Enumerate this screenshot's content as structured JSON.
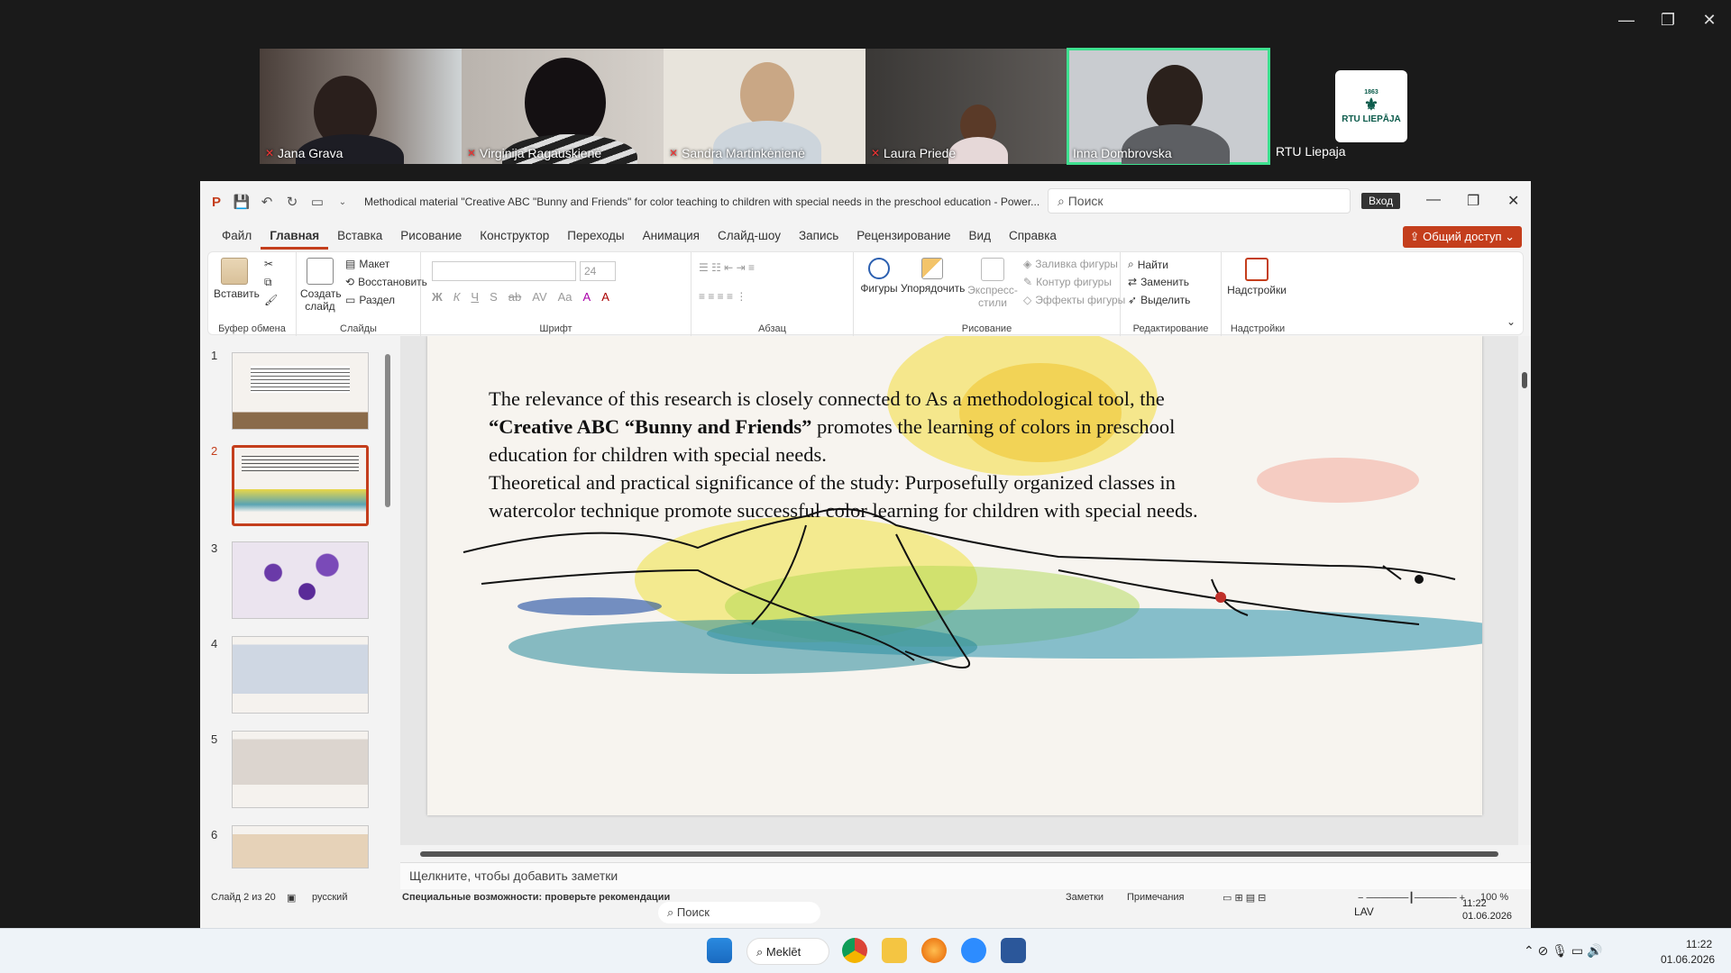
{
  "window_controls": {
    "minimize": "—",
    "restore": "❐",
    "close": "✕"
  },
  "participants": [
    {
      "name": "Jana Grava",
      "muted": true
    },
    {
      "name": "Virginija Ragauskienė",
      "muted": true
    },
    {
      "name": "Sandra Martinkėnienė",
      "muted": true
    },
    {
      "name": "Laura Priede",
      "muted": true
    },
    {
      "name": "Inna Dombrovska",
      "muted": false,
      "active": true
    },
    {
      "name": "RTU Liepaja",
      "muted": false
    }
  ],
  "rtu_logo": {
    "text": "RTU LIEPĀJA",
    "year": "1863"
  },
  "ppt": {
    "title": "Methodical material \"Creative ABC \"Bunny and Friends\" for color teaching to children with special needs in the  preschool education  -  Power...",
    "search_placeholder": "Поиск",
    "signin": "Вход",
    "tabs": [
      "Файл",
      "Главная",
      "Вставка",
      "Рисование",
      "Конструктор",
      "Переходы",
      "Анимация",
      "Слайд-шоу",
      "Запись",
      "Рецензирование",
      "Вид",
      "Справка"
    ],
    "selected_tab": "Главная",
    "share": "Общий доступ",
    "ribbon": {
      "paste": "Вставить",
      "clipboard": "Буфер обмена",
      "new_slide": "Создать слайд",
      "layout": "Макет",
      "reset": "Восстановить",
      "section": "Раздел",
      "slides": "Слайды",
      "font_size": "24",
      "font": "Шрифт",
      "paragraph": "Абзац",
      "shapes": "Фигуры",
      "arrange": "Упорядочить",
      "quick_styles": "Экспресс-стили",
      "shape_fill": "Заливка фигуры",
      "shape_outline": "Контур фигуры",
      "shape_effects": "Эффекты фигуры",
      "drawing": "Рисование",
      "find": "Найти",
      "replace": "Заменить",
      "select": "Выделить",
      "editing": "Редактирование",
      "addins": "Надстройки",
      "addins_group": "Надстройки"
    },
    "slide_text": {
      "line1": "The relevance of this research is closely connected to As a methodological tool, the",
      "line2_bold": "“Creative ABC “Bunny and Friends”",
      "line2_rest": " promotes the learning of colors in preschool",
      "line3": "education for children with special needs.",
      "line4": "Theoretical and practical significance of the study: Purposefully organized classes in",
      "line5": "watercolor technique promote successful color learning for children with special needs."
    },
    "thumb_numbers": [
      "1",
      "2",
      "3",
      "4",
      "5",
      "6"
    ],
    "notes_placeholder": "Щелкните, чтобы добавить заметки",
    "status": {
      "slide": "Слайд 2 из 20",
      "language": "русский",
      "accessibility": "Специальные возможности: проверьте рекомендации",
      "notes": "Заметки",
      "comments": "Примечания",
      "zoom": "100 %"
    },
    "inner_taskbar": {
      "search": "Поиск",
      "lang": "LAV",
      "time": "11:22",
      "date": "01.06.2026"
    }
  },
  "taskbar": {
    "search": "Meklēt",
    "time": "11:22",
    "date": "01.06.2026"
  }
}
